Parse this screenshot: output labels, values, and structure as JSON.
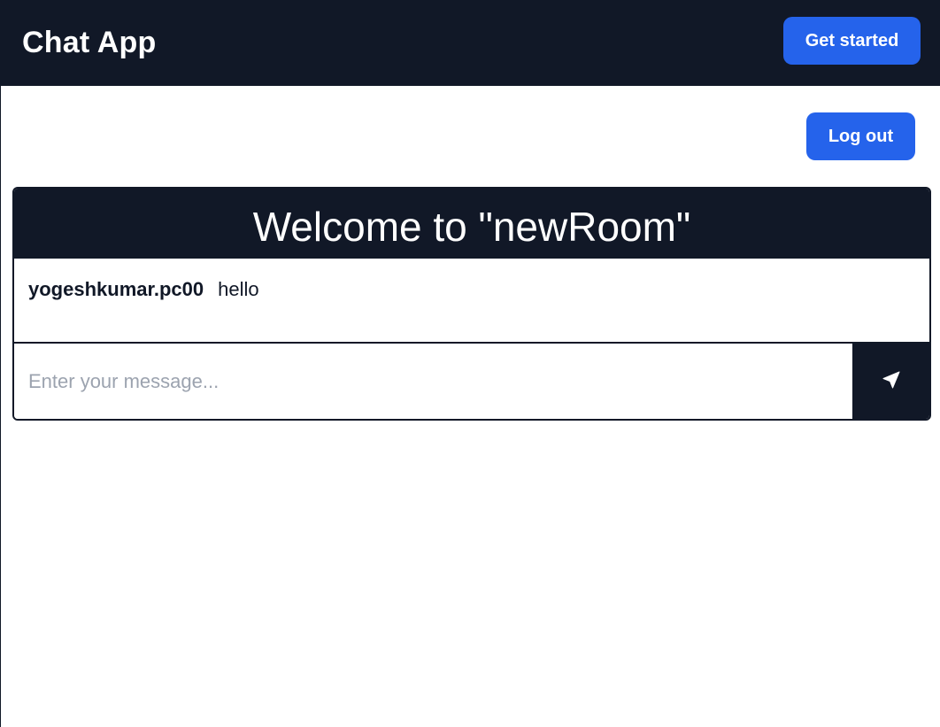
{
  "navbar": {
    "brand": "Chat App",
    "get_started_label": "Get started"
  },
  "actions": {
    "logout_label": "Log out"
  },
  "room": {
    "title": "Welcome to \"newRoom\""
  },
  "messages": [
    {
      "user": "yogeshkumar.pc00",
      "text": "hello"
    }
  ],
  "composer": {
    "placeholder": "Enter your message...",
    "value": "",
    "send_icon": "send-icon"
  },
  "colors": {
    "dark": "#111827",
    "accent": "#2563eb",
    "placeholder": "#9ca3af"
  }
}
